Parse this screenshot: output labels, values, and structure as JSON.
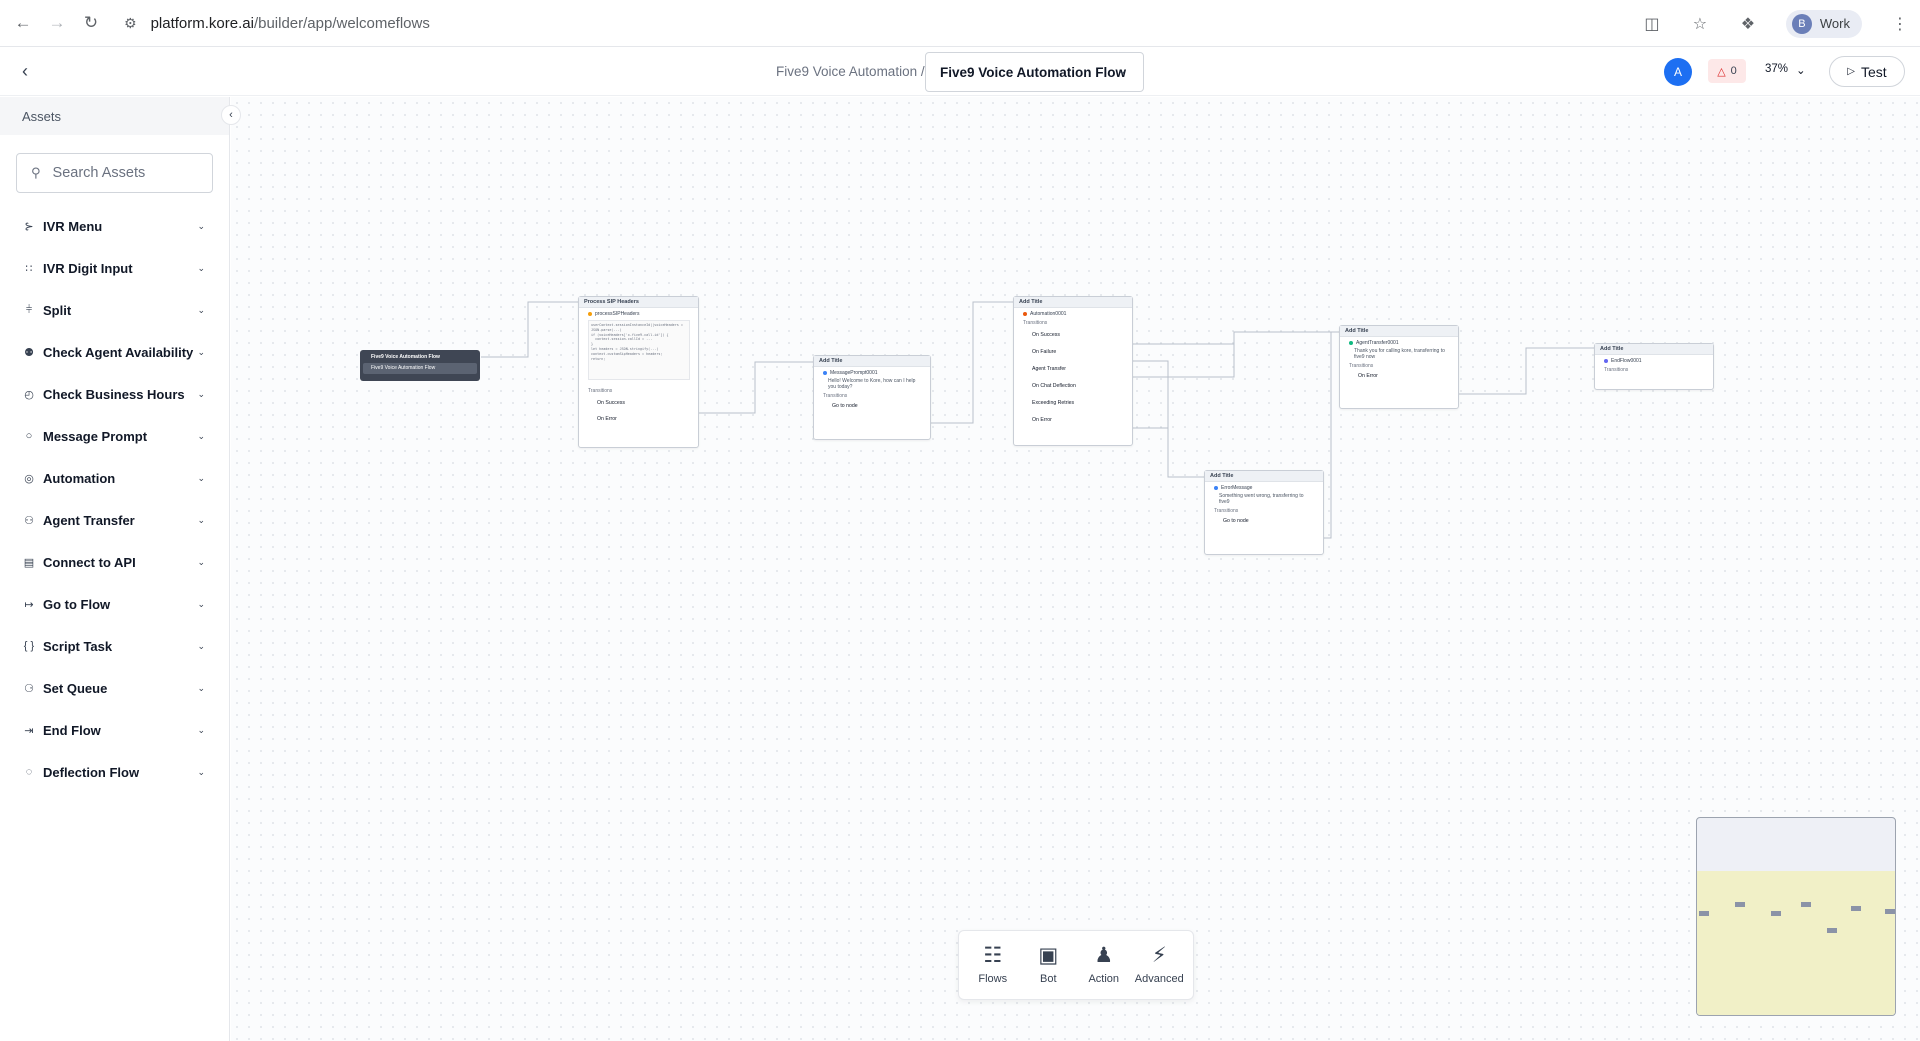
{
  "browser": {
    "url_host": "platform.kore.ai",
    "url_path": "/builder/app/welcomeflows",
    "profile_initial": "B",
    "profile_name": "Work"
  },
  "header": {
    "breadcrumb": "Five9 Voice Automation",
    "separator": "/",
    "current_flow": "Five9 Voice Automation Flow",
    "user_initial": "A",
    "warnings_count": "0",
    "zoom": "37%",
    "test_label": "Test"
  },
  "sidebar": {
    "title": "Assets",
    "search_placeholder": "Search Assets",
    "items": [
      {
        "label": "IVR Menu",
        "icon": "ivr-menu-icon"
      },
      {
        "label": "IVR Digit Input",
        "icon": "digit-grid-icon"
      },
      {
        "label": "Split",
        "icon": "split-icon"
      },
      {
        "label": "Check Agent Availability",
        "icon": "agent-check-icon"
      },
      {
        "label": "Check Business Hours",
        "icon": "clock-icon"
      },
      {
        "label": "Message Prompt",
        "icon": "chat-bubble-icon"
      },
      {
        "label": "Automation",
        "icon": "automation-icon"
      },
      {
        "label": "Agent Transfer",
        "icon": "agent-transfer-icon"
      },
      {
        "label": "Connect to API",
        "icon": "api-icon"
      },
      {
        "label": "Go to Flow",
        "icon": "go-to-flow-icon"
      },
      {
        "label": "Script Task",
        "icon": "braces-icon"
      },
      {
        "label": "Set Queue",
        "icon": "queue-icon"
      },
      {
        "label": "End Flow",
        "icon": "end-flow-icon"
      },
      {
        "label": "Deflection Flow",
        "icon": "deflection-icon"
      }
    ]
  },
  "canvas": {
    "start": {
      "title": "Five9 Voice Automation Flow",
      "sub": "Five9 Voice Automation Flow"
    },
    "sip": {
      "title": "Process SIP Headers",
      "script": "processSIPHeaders",
      "code": "userContext.sessionInstanceId||voiceHeaders = JSON.parse(...)\nif (voiceHeaders['x-five9-call-id']) {\n  context.session.callId = ...\n}\nlet headers = JSON.stringify(...)\ncontext.customSipHeaders = headers;\nreturn;",
      "transitions": "Transitions",
      "t1": "On Success",
      "t2": "On Error"
    },
    "msg": {
      "title": "Add Title",
      "name": "MessagePrompt0001",
      "text": "Hello! Welcome to Kore, how can I help you today?",
      "transitions": "Transitions",
      "t1": "Go to node"
    },
    "auto": {
      "title": "Add Title",
      "name": "Automation0001",
      "transitions": "Transitions",
      "t1": "On Success",
      "t2": "On Failure",
      "t3": "Agent Transfer",
      "t4": "On Chat Deflection",
      "t5": "Exceeding Retries",
      "t6": "On Error"
    },
    "agent": {
      "title": "Add Title",
      "name": "AgentTransfer0001",
      "text": "Thank you for calling kore, transferring to five9 now",
      "transitions": "Transitions",
      "t1": "On Error"
    },
    "err": {
      "title": "Add Title",
      "name": "ErrorMessage",
      "text": "Something went wrong, transferring to five9",
      "transitions": "Transitions",
      "t1": "Go to node"
    },
    "end": {
      "title": "Add Title",
      "name": "EndFlow0001",
      "transitions": "Transitions"
    }
  },
  "toolbar": {
    "flows": "Flows",
    "bot": "Bot",
    "action": "Action",
    "advanced": "Advanced"
  },
  "colors": {
    "accent": "#1d6ff2",
    "warning_bg": "#fde8e8",
    "start_node": "#3f4654",
    "minimap_view": "#f1f0c7"
  }
}
